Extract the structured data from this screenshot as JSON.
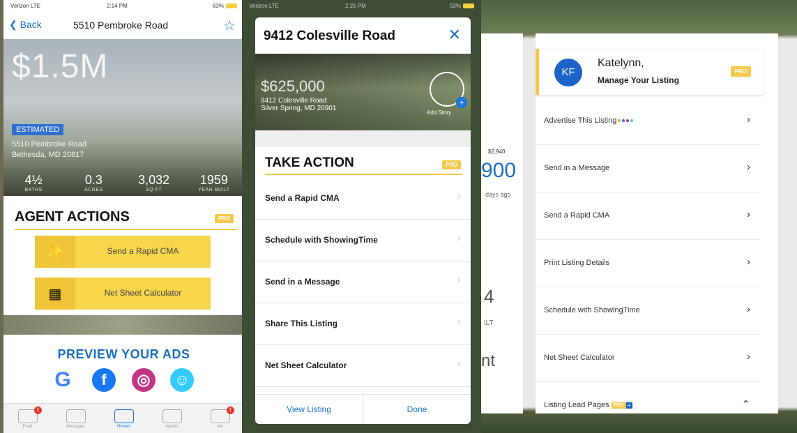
{
  "panel1": {
    "status": {
      "carrier": "Verizon LTE",
      "time": "2:14 PM",
      "battery": "63%"
    },
    "nav": {
      "back_label": "Back",
      "title": "5510 Pembroke Road"
    },
    "hero": {
      "price": "$1.5M",
      "badge": "ESTIMATED",
      "address_line1": "5510 Pembroke Road",
      "address_line2": "Bethesda, MD 20817"
    },
    "stats": [
      {
        "value": "4½",
        "label": "BATHS"
      },
      {
        "value": "0.3",
        "label": "ACRES"
      },
      {
        "value": "3,032",
        "label": "SQ FT"
      },
      {
        "value": "1959",
        "label": "YEAR BUILT"
      }
    ],
    "section_title": "AGENT ACTIONS",
    "pro_label": "PRO",
    "actions": [
      {
        "label": "Send a Rapid CMA",
        "icon": "magic-wand-icon"
      },
      {
        "label": "Net Sheet Calculator",
        "icon": "calculator-icon"
      }
    ],
    "preview_title": "PREVIEW YOUR ADS",
    "social": [
      {
        "glyph": "G",
        "name": "google-icon",
        "color": "#ffffff"
      },
      {
        "glyph": "f",
        "name": "facebook-icon",
        "color": "#1877f2"
      },
      {
        "glyph": "◎",
        "name": "instagram-icon",
        "color": "#c13584"
      },
      {
        "glyph": "☺",
        "name": "waze-icon",
        "color": "#33ccff"
      }
    ],
    "tabs": [
      {
        "label": "Feed",
        "icon": "feed-icon",
        "badge": "1"
      },
      {
        "label": "Messages",
        "icon": "messages-icon",
        "badge": ""
      },
      {
        "label": "Homes",
        "icon": "map-pin-icon",
        "badge": ""
      },
      {
        "label": "Agents",
        "icon": "pro-icon",
        "badge": ""
      },
      {
        "label": "Me",
        "icon": "me-icon",
        "badge": "1"
      }
    ]
  },
  "panel2": {
    "status": {
      "carrier": "Verizon LTE",
      "time": "2:25 PM",
      "battery": "53%"
    },
    "title": "9412 Colesville Road",
    "hero": {
      "price": "$625,000",
      "address_line1": "9412 Colesville Road",
      "address_line2": "Silver Spring, MD 20901",
      "add_story": "Add Story"
    },
    "section_title": "TAKE ACTION",
    "pro_label": "PRO",
    "rows": [
      {
        "label": "Send a Rapid CMA"
      },
      {
        "label": "Schedule with ShowingTime"
      },
      {
        "label": "Send in a Message"
      },
      {
        "label": "Share This Listing"
      },
      {
        "label": "Net Sheet Calculator"
      }
    ],
    "footer": {
      "left": "View Listing",
      "right": "Done"
    }
  },
  "panel3": {
    "behind": {
      "price_change": "$2,940",
      "price_partial": "900",
      "days": "days ago",
      "beds": "4",
      "built": "ILT",
      "logo": "nt"
    },
    "card": {
      "initials": "KF",
      "name": "Katelynn,",
      "subtitle": "Manage Your Listing",
      "pro": "PRO"
    },
    "rows": [
      {
        "label": "Advertise This Listing",
        "dots": true,
        "chevron": "›"
      },
      {
        "label": "Send in a Message",
        "dots": false,
        "chevron": "›"
      },
      {
        "label": "Send a Rapid CMA",
        "dots": false,
        "chevron": "›"
      },
      {
        "label": "Print Listing Details",
        "dots": false,
        "chevron": "›"
      },
      {
        "label": "Schedule with ShowingTime",
        "dots": false,
        "chevron": "›"
      },
      {
        "label": "Net Sheet Calculator",
        "dots": false,
        "chevron": "›"
      },
      {
        "label": "Listing Lead Pages",
        "dots": false,
        "chevron": "⌃",
        "pro": "PRO"
      }
    ]
  }
}
